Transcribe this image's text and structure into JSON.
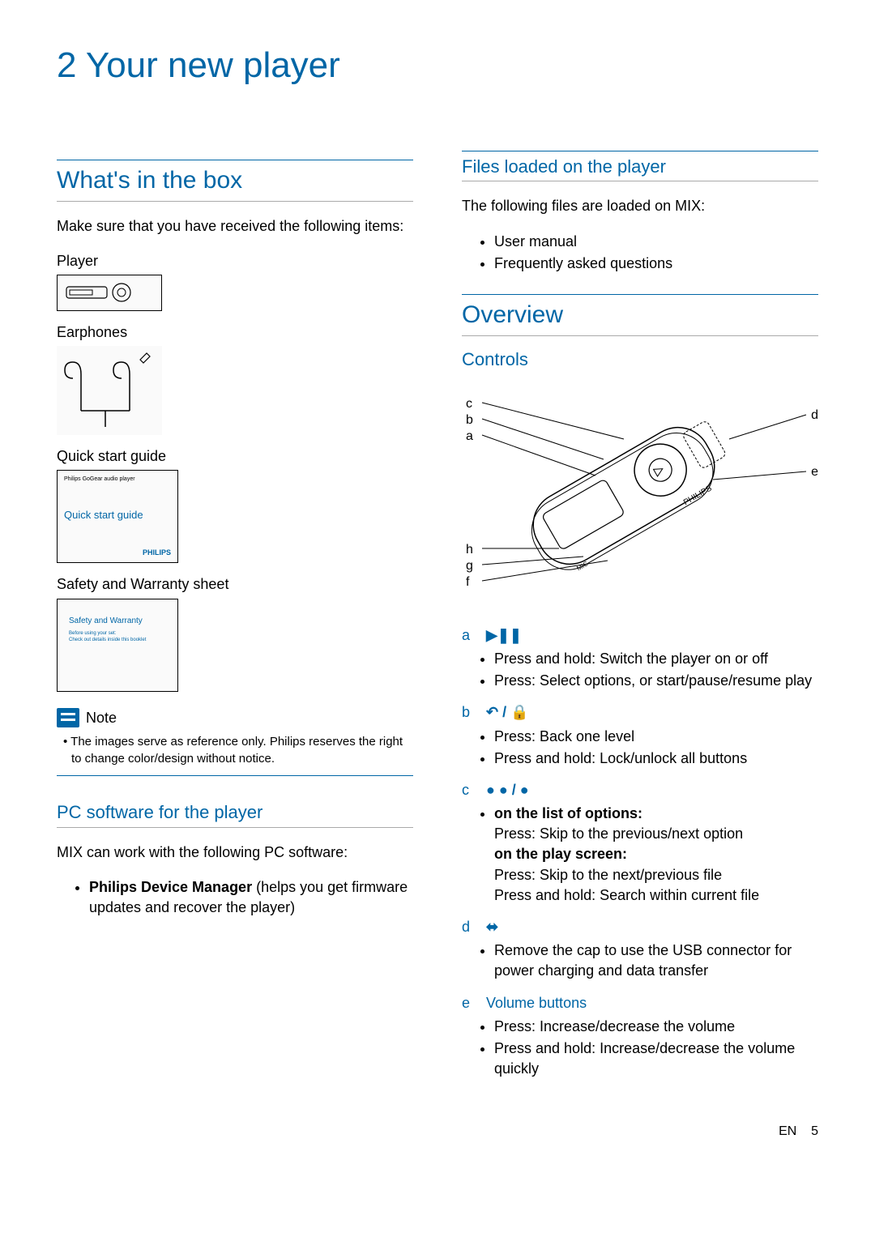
{
  "chapter": "2   Your new player",
  "left": {
    "whats_in_box": {
      "heading": "What's in the box",
      "intro": "Make sure that you have received the following items:",
      "items": {
        "player": "Player",
        "earphones": "Earphones",
        "qsg": "Quick start guide",
        "qsg_inner1": "Philips GoGear audio player",
        "qsg_inner2": "Quick start guide",
        "qsg_brand": "PHILIPS",
        "safety": "Safety and Warranty sheet",
        "safety_inner1": "Safety and Warranty",
        "safety_inner2": "Before using your set:\nCheck out details inside this booklet"
      }
    },
    "note": {
      "label": "Note",
      "text": "The images serve as reference only. Philips reserves the right to change color/design without notice."
    },
    "pc_software": {
      "heading": "PC software for the player",
      "intro": "MIX can work with the following PC software:",
      "bullet_bold": "Philips Device Manager",
      "bullet_rest": " (helps you get firmware updates and recover the player)"
    }
  },
  "right": {
    "files": {
      "heading": "Files loaded on the player",
      "intro": "The following files are loaded on MIX:",
      "items": [
        "User manual",
        "Frequently asked questions"
      ]
    },
    "overview": {
      "heading": "Overview",
      "controls_heading": "Controls",
      "diagram_labels": [
        "a",
        "b",
        "c",
        "d",
        "e",
        "f",
        "g",
        "h"
      ],
      "rows": [
        {
          "letter": "a",
          "icon": "▶❚❚",
          "bullets": [
            "Press and hold: Switch the player on or off",
            "Press: Select options, or start/pause/resume play"
          ]
        },
        {
          "letter": "b",
          "icon": "↶ / 🔒",
          "bullets": [
            "Press: Back one level",
            "Press and hold: Lock/unlock all buttons"
          ]
        },
        {
          "letter": "c",
          "icon": "● ● / ●",
          "sub": [
            {
              "bold": "on the list of options:",
              "text": "Press: Skip to the previous/next option"
            },
            {
              "bold": "on the play screen:",
              "text": "Press: Skip to the next/previous file\nPress and hold: Search within current file"
            }
          ]
        },
        {
          "letter": "d",
          "icon": "⬌",
          "bullets": [
            "Remove the cap to use the USB connector for power charging and data transfer"
          ]
        },
        {
          "letter": "e",
          "label": "Volume buttons",
          "bullets": [
            "Press: Increase/decrease the volume",
            "Press and hold: Increase/decrease the volume quickly"
          ]
        }
      ]
    }
  },
  "footer": {
    "lang": "EN",
    "page": "5"
  }
}
